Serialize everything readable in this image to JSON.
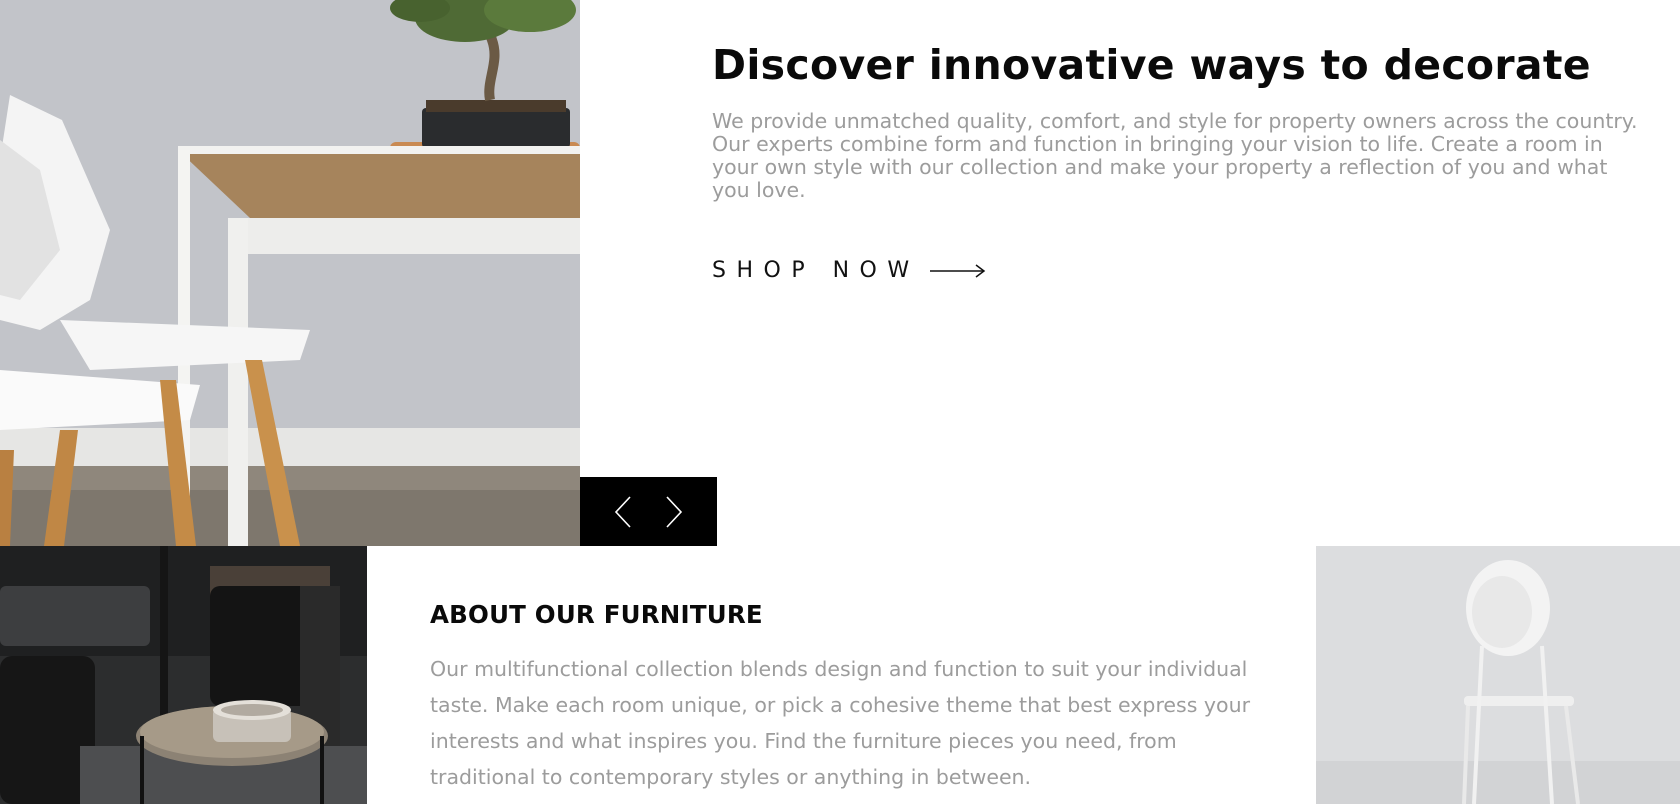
{
  "hero": {
    "title": "Discover innovative ways to decorate",
    "description": "We provide unmatched quality, comfort, and style for property owners across the country. Our experts combine form and function in bringing your vision to life. Create a room in your own style with our collection and make your property a reflection of you and what you love.",
    "cta_label": "SHOP NOW",
    "cta_icon": "arrow-right-icon",
    "image_subject": "white chairs at wooden table with bonsai"
  },
  "slider": {
    "prev_icon": "chevron-left-icon",
    "next_icon": "chevron-right-icon"
  },
  "about": {
    "title": "ABOUT OUR FURNITURE",
    "description": "Our multifunctional collection blends design and function to suit your individual taste. Make each room unique, or pick a cohesive theme that best express your interests and what inspires you. Find the furniture pieces you need, from traditional to contemporary styles or anything in between."
  },
  "colors": {
    "heading": "#0a0a0a",
    "body_text": "#9c9c9c",
    "slider_bg": "#000000",
    "page_bg": "#ffffff"
  }
}
